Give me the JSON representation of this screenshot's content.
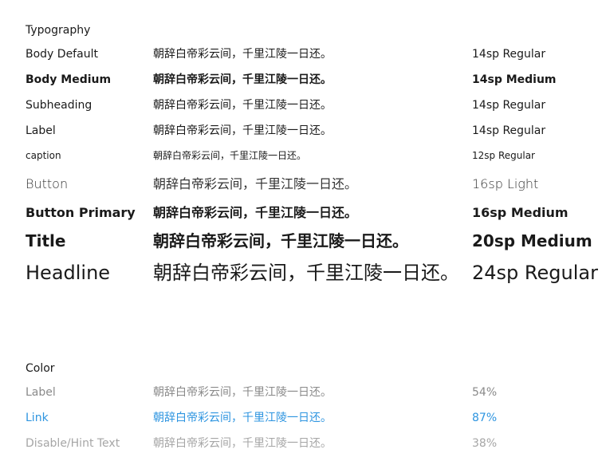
{
  "typography": {
    "heading": "Typography",
    "rows": [
      {
        "name": "Body Default",
        "sample": "朝辞白帝彩云间，千里江陵一日还。",
        "spec": "14sp Regular"
      },
      {
        "name": "Body Medium",
        "sample": "朝辞白帝彩云间，千里江陵一日还。",
        "spec": "14sp Medium"
      },
      {
        "name": "Subheading",
        "sample": "朝辞白帝彩云间，千里江陵一日还。",
        "spec": "14sp Regular"
      },
      {
        "name": "Label",
        "sample": "朝辞白帝彩云间，千里江陵一日还。",
        "spec": "14sp Regular"
      },
      {
        "name": "caption",
        "sample": "朝辞白帝彩云间，千里江陵一日还。",
        "spec": "12sp Regular"
      },
      {
        "name": "Button",
        "sample": "朝辞白帝彩云间，千里江陵一日还。",
        "spec": "16sp Light"
      },
      {
        "name": "Button Primary",
        "sample": "朝辞白帝彩云间，千里江陵一日还。",
        "spec": "16sp Medium"
      },
      {
        "name": "Title",
        "sample": "朝辞白帝彩云间，千里江陵一日还。",
        "spec": "20sp Medium"
      },
      {
        "name": "Headline",
        "sample": "朝辞白帝彩云间，千里江陵一日还。",
        "spec": "24sp Regular"
      }
    ]
  },
  "color": {
    "heading": "Color",
    "rows": [
      {
        "name": "Label",
        "sample": "朝辞白帝彩云间，千里江陵一日还。",
        "spec": "54%",
        "color": "#8a8a8a"
      },
      {
        "name": "Link",
        "sample": "朝辞白帝彩云间，千里江陵一日还。",
        "spec": "87%",
        "color": "#2e95e0"
      },
      {
        "name": "Disable/Hint Text",
        "sample": "朝辞白帝彩云间，千里江陵一日还。",
        "spec": "38%",
        "color": "#a6a6a6"
      }
    ]
  }
}
